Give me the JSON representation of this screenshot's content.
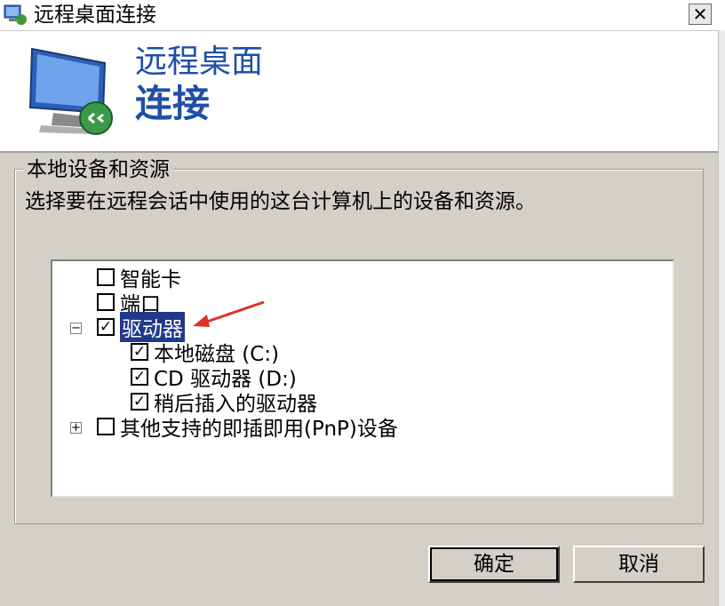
{
  "window": {
    "title": "远程桌面连接",
    "close_glyph": "✕"
  },
  "banner": {
    "heading_line1": "远程桌面",
    "heading_line2": "连接"
  },
  "group": {
    "label": "本地设备和资源",
    "description": "选择要在远程会话中使用的这台计算机上的设备和资源。"
  },
  "tree": {
    "items": [
      {
        "label": "智能卡",
        "checked": false
      },
      {
        "label": "端口",
        "checked": false
      },
      {
        "label": "驱动器",
        "checked": true,
        "expander": "−",
        "selected": true
      },
      {
        "label": "本地磁盘 (C:)",
        "checked": true
      },
      {
        "label": "CD 驱动器 (D:)",
        "checked": true
      },
      {
        "label": "稍后插入的驱动器",
        "checked": true
      },
      {
        "label": "其他支持的即插即用(PnP)设备",
        "checked": false,
        "expander": "+"
      }
    ]
  },
  "buttons": {
    "ok": "确定",
    "cancel": "取消"
  },
  "colors": {
    "accent": "#1f4fa6",
    "selection": "#1f3a8a",
    "annotation_arrow": "#e0322a"
  },
  "icons": {
    "title": "remote-desktop-icon",
    "banner": "monitor-icon",
    "arrow": "red-arrow-icon"
  }
}
